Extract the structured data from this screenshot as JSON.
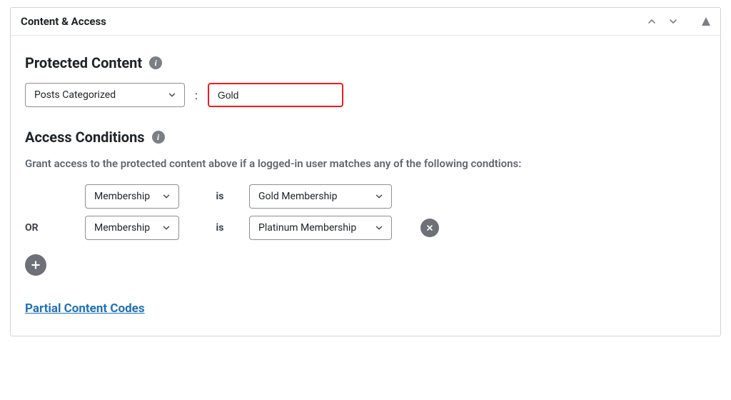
{
  "panel": {
    "title": "Content & Access"
  },
  "protected_content": {
    "heading": "Protected Content",
    "type_select": {
      "selected": "Posts Categorized"
    },
    "value_field": {
      "value": "Gold"
    }
  },
  "access_conditions": {
    "heading": "Access Conditions",
    "description": "Grant access to the protected content above if a logged-in user matches any of the following condtions:",
    "or_label": "OR",
    "is_label": "is",
    "conditions": [
      {
        "attribute": "Membership",
        "value": "Gold Membership",
        "removable": false
      },
      {
        "attribute": "Membership",
        "value": "Platinum Membership",
        "removable": true
      }
    ]
  },
  "partial_codes": {
    "link_text": "Partial Content Codes"
  }
}
